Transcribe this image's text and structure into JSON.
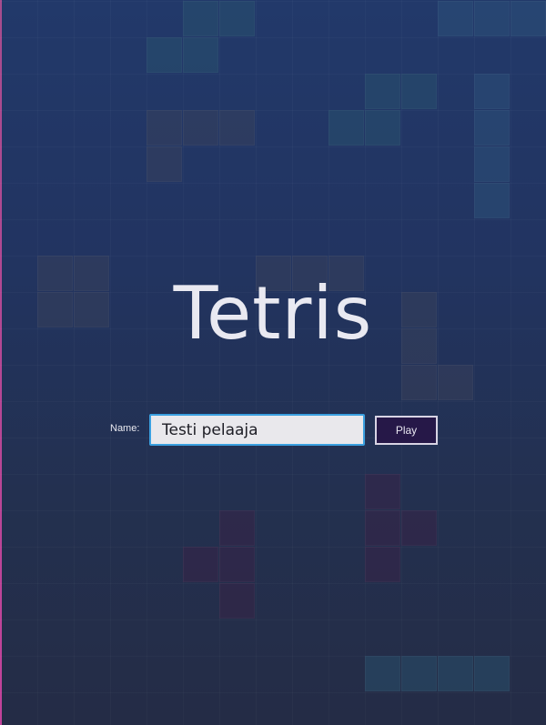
{
  "app": {
    "title": "Tetris"
  },
  "form": {
    "name_label": "Name:",
    "name_value": "Testi pelaaja",
    "play_label": "Play"
  },
  "colors": {
    "background_top": "#22396a",
    "background_bottom": "#242c46",
    "input_focus_border": "#3aa0e0",
    "play_button_bg": "#261848",
    "title_text": "#e9e9f1"
  }
}
